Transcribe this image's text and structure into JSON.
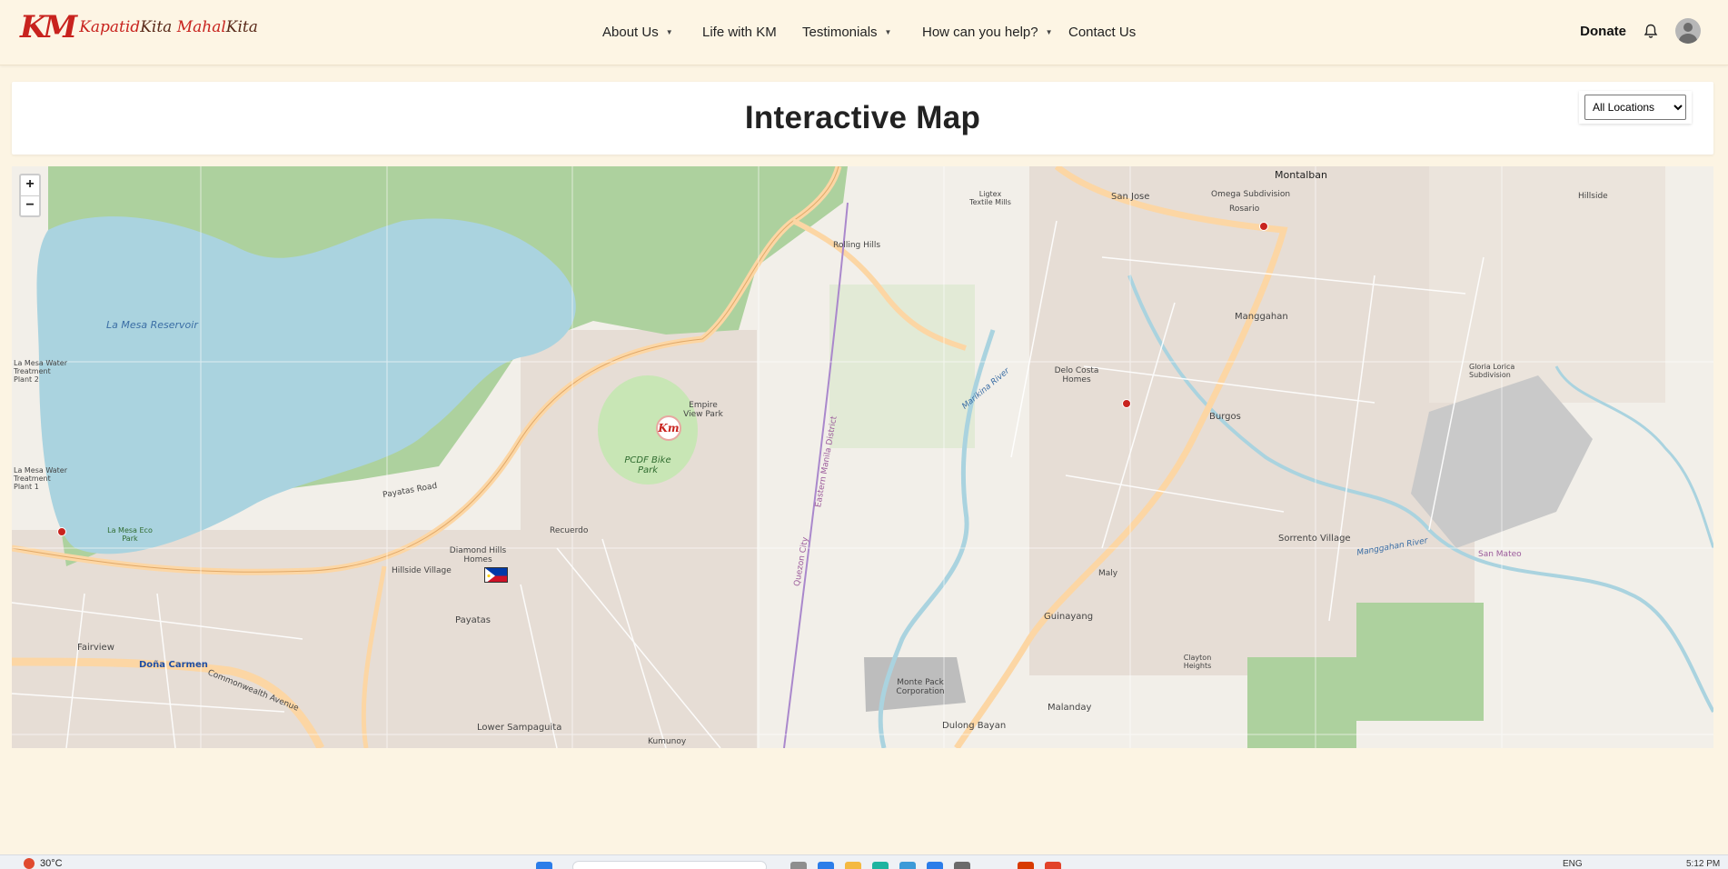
{
  "brand": {
    "logo_mark": "KM",
    "name_part1": "Kapatid",
    "name_part2": "Kita",
    "name_part3": "Mahal",
    "name_part4": "Kita"
  },
  "nav": {
    "items": [
      {
        "label": "About Us",
        "has_dropdown": true
      },
      {
        "label": "Life with KM",
        "has_dropdown": false
      },
      {
        "label": "Testimonials",
        "has_dropdown": true
      },
      {
        "label": "How can you help?",
        "has_dropdown": true
      },
      {
        "label": "Contact Us",
        "has_dropdown": false
      }
    ],
    "donate_label": "Donate",
    "bell_icon": "bell-icon",
    "avatar_icon": "user-avatar-icon"
  },
  "page": {
    "title": "Interactive Map",
    "location_filter": {
      "selected": "All Locations",
      "options": [
        "All Locations"
      ]
    }
  },
  "map": {
    "zoom_in": "+",
    "zoom_out": "−",
    "labels": {
      "la_mesa": "La Mesa Reservoir",
      "montalban": "Montalban",
      "san_jose": "San Jose",
      "rosario": "Rosario",
      "omega": "Omega Subdivision",
      "manggahan": "Manggahan",
      "burgos": "Burgos",
      "sorrento": "Sorrento Village",
      "guinayang": "Guinayang",
      "malanday": "Malanday",
      "monte_pack": "Monte Pack Corporation",
      "dulong_bayan": "Dulong Bayan",
      "clayton": "Clayton Heights",
      "dona_carmen": "Doña Carmen",
      "fairview": "Fairview",
      "payatas": "Payatas",
      "lower_sampaguita": "Lower Sampaguita",
      "kumunoy": "Kumunoy",
      "diamond_hills": "Diamond Hills Homes",
      "hillside": "Hillside Village",
      "recuerdo": "Recuerdo",
      "pcdf": "PCDF Bike Park",
      "empire_view": "Empire View Park",
      "rolling_hills": "Rolling Hills",
      "la_mesa_eco": "La Mesa Eco Park",
      "payatas_road": "Payatas Road",
      "commonwealth": "Commonwealth Avenue",
      "delo_costa": "Delo Costa Homes",
      "hillside_top": "Hillside",
      "gloria": "Gloria Lorica Subdivision",
      "marikina_river": "Marikina River",
      "manggahan_river": "Manggahan River",
      "san_mateo": "San Mateo",
      "quezon_city": "Quezon City",
      "eastern_manila": "Eastern Manila District",
      "treatment1": "La Mesa Water Treatment Plant 1",
      "treatment2": "La Mesa Water Treatment Plant 2",
      "maly": "Maly",
      "ligtex": "Ligtex Textile Mills"
    }
  },
  "taskbar": {
    "weather": "30°C",
    "language": "ENG",
    "time": "5:12 PM"
  },
  "colors": {
    "page_bg": "#fcf4e3",
    "brand_red": "#c8231e",
    "water": "#aad3df",
    "forest": "#add19e",
    "road_major": "#fcd6a4"
  }
}
